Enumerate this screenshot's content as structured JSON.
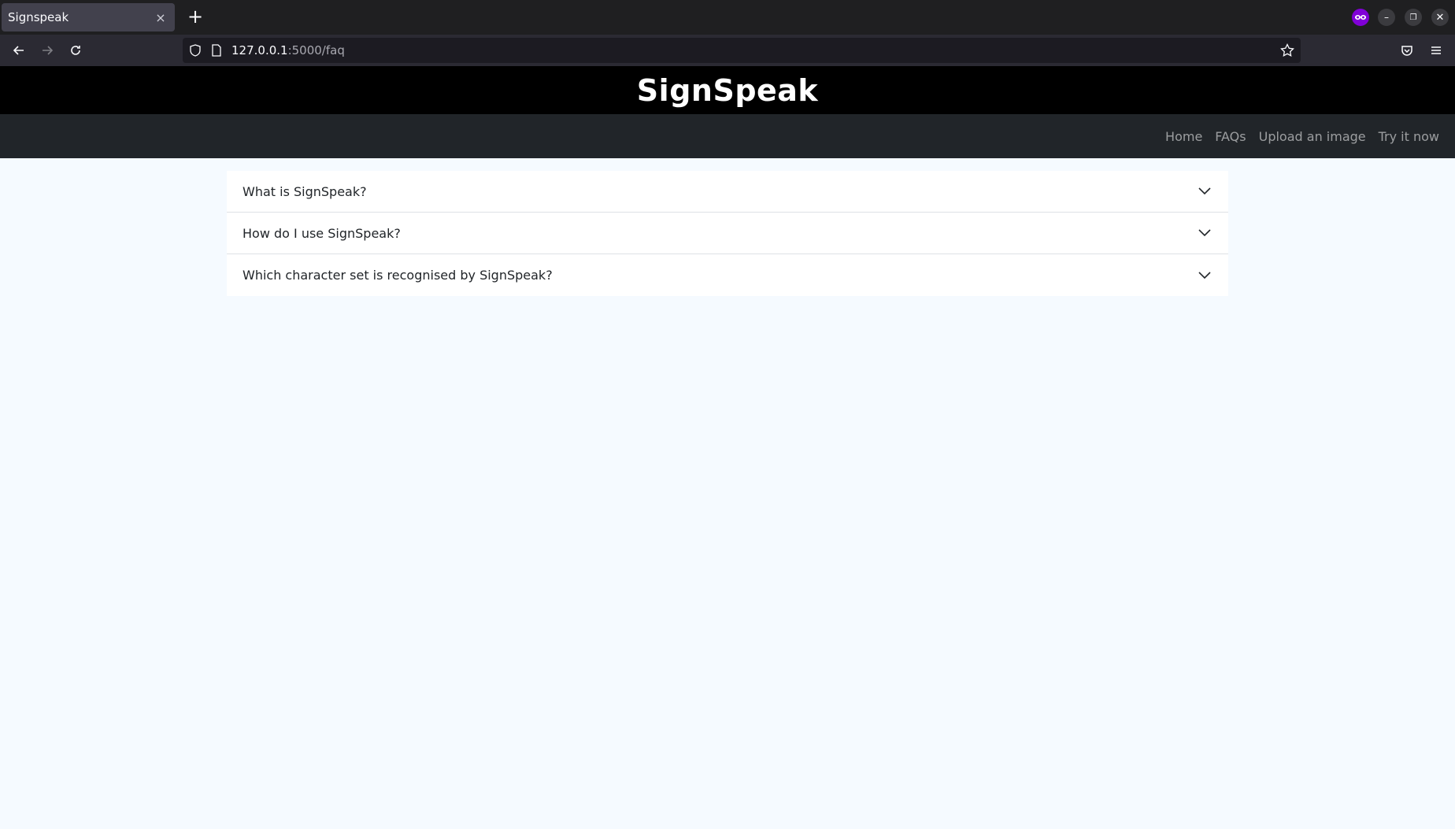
{
  "browser": {
    "tab_title": "Signspeak",
    "tab_close": "×",
    "new_tab": "+",
    "url_host": "127.0.0.1",
    "url_rest": ":5000/faq"
  },
  "site": {
    "title": "SignSpeak",
    "nav": [
      "Home",
      "FAQs",
      "Upload an image",
      "Try it now"
    ]
  },
  "faq": {
    "questions": [
      "What is SignSpeak?",
      "How do I use SignSpeak?",
      "Which character set is recognised by SignSpeak?"
    ]
  }
}
